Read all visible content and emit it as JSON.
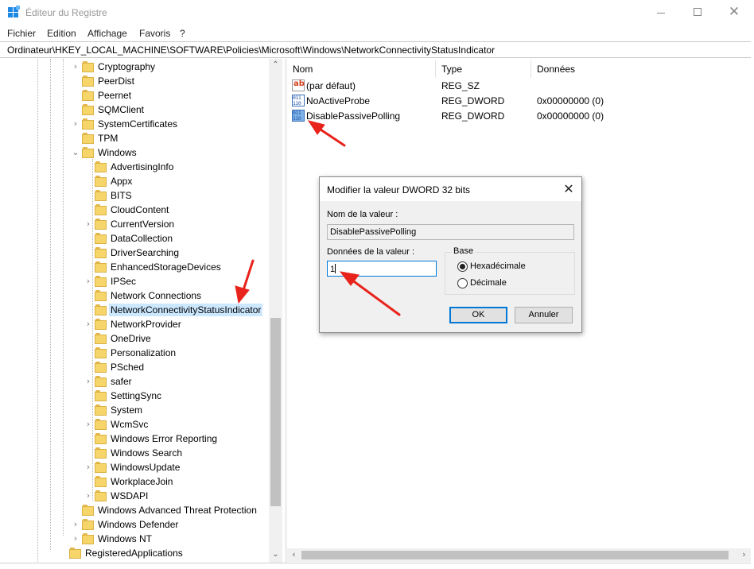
{
  "window": {
    "title": "Éditeur du Registre",
    "close_glyph": "✕"
  },
  "menu": [
    "Fichier",
    "Edition",
    "Affichage",
    "Favoris",
    "?"
  ],
  "address": "Ordinateur\\HKEY_LOCAL_MACHINE\\SOFTWARE\\Policies\\Microsoft\\Windows\\NetworkConnectivityStatusIndicator",
  "tree": {
    "items": [
      {
        "label": "Cryptography",
        "level": 1,
        "expander": "collapsed"
      },
      {
        "label": "PeerDist",
        "level": 1,
        "expander": "none"
      },
      {
        "label": "Peernet",
        "level": 1,
        "expander": "none"
      },
      {
        "label": "SQMClient",
        "level": 1,
        "expander": "none"
      },
      {
        "label": "SystemCertificates",
        "level": 1,
        "expander": "collapsed"
      },
      {
        "label": "TPM",
        "level": 1,
        "expander": "none"
      },
      {
        "label": "Windows",
        "level": 1,
        "expander": "expanded"
      },
      {
        "label": "AdvertisingInfo",
        "level": 2,
        "expander": "none"
      },
      {
        "label": "Appx",
        "level": 2,
        "expander": "none"
      },
      {
        "label": "BITS",
        "level": 2,
        "expander": "none"
      },
      {
        "label": "CloudContent",
        "level": 2,
        "expander": "none"
      },
      {
        "label": "CurrentVersion",
        "level": 2,
        "expander": "collapsed"
      },
      {
        "label": "DataCollection",
        "level": 2,
        "expander": "none"
      },
      {
        "label": "DriverSearching",
        "level": 2,
        "expander": "none"
      },
      {
        "label": "EnhancedStorageDevices",
        "level": 2,
        "expander": "none"
      },
      {
        "label": "IPSec",
        "level": 2,
        "expander": "collapsed"
      },
      {
        "label": "Network Connections",
        "level": 2,
        "expander": "none"
      },
      {
        "label": "NetworkConnectivityStatusIndicator",
        "level": 2,
        "expander": "none",
        "selected": true
      },
      {
        "label": "NetworkProvider",
        "level": 2,
        "expander": "collapsed"
      },
      {
        "label": "OneDrive",
        "level": 2,
        "expander": "none"
      },
      {
        "label": "Personalization",
        "level": 2,
        "expander": "none"
      },
      {
        "label": "PSched",
        "level": 2,
        "expander": "none"
      },
      {
        "label": "safer",
        "level": 2,
        "expander": "collapsed"
      },
      {
        "label": "SettingSync",
        "level": 2,
        "expander": "none"
      },
      {
        "label": "System",
        "level": 2,
        "expander": "none"
      },
      {
        "label": "WcmSvc",
        "level": 2,
        "expander": "collapsed"
      },
      {
        "label": "Windows Error Reporting",
        "level": 2,
        "expander": "none"
      },
      {
        "label": "Windows Search",
        "level": 2,
        "expander": "none"
      },
      {
        "label": "WindowsUpdate",
        "level": 2,
        "expander": "collapsed"
      },
      {
        "label": "WorkplaceJoin",
        "level": 2,
        "expander": "none"
      },
      {
        "label": "WSDAPI",
        "level": 2,
        "expander": "collapsed"
      },
      {
        "label": "Windows Advanced Threat Protection",
        "level": 1,
        "expander": "none"
      },
      {
        "label": "Windows Defender",
        "level": 1,
        "expander": "collapsed"
      },
      {
        "label": "Windows NT",
        "level": 1,
        "expander": "collapsed"
      },
      {
        "label": "RegisteredApplications",
        "level": 0,
        "expander": "none"
      }
    ]
  },
  "list": {
    "headers": {
      "name": "Nom",
      "type": "Type",
      "data": "Données"
    },
    "rows": [
      {
        "name": "(par défaut)",
        "type": "REG_SZ",
        "data": "",
        "icon": "string-value-icon"
      },
      {
        "name": "NoActiveProbe",
        "type": "REG_DWORD",
        "data": "0x00000000 (0)",
        "icon": "dword-value-icon"
      },
      {
        "name": "DisablePassivePolling",
        "type": "REG_DWORD",
        "data": "0x00000000 (0)",
        "icon": "dword-value-icon"
      }
    ]
  },
  "dialog": {
    "title": "Modifier la valeur DWORD 32 bits",
    "close_glyph": "✕",
    "value_name_label": "Nom de la valeur :",
    "value_name": "DisablePassivePolling",
    "value_data_label": "Données de la valeur :",
    "value_data": "1",
    "base_label": "Base",
    "base_options": [
      {
        "label": "Hexadécimale",
        "checked": true
      },
      {
        "label": "Décimale",
        "checked": false
      }
    ],
    "ok_label": "OK",
    "cancel_label": "Annuler"
  },
  "colors": {
    "selection": "#cce8ff",
    "annotation_arrow": "#e8231b",
    "focus": "#0078d7"
  }
}
